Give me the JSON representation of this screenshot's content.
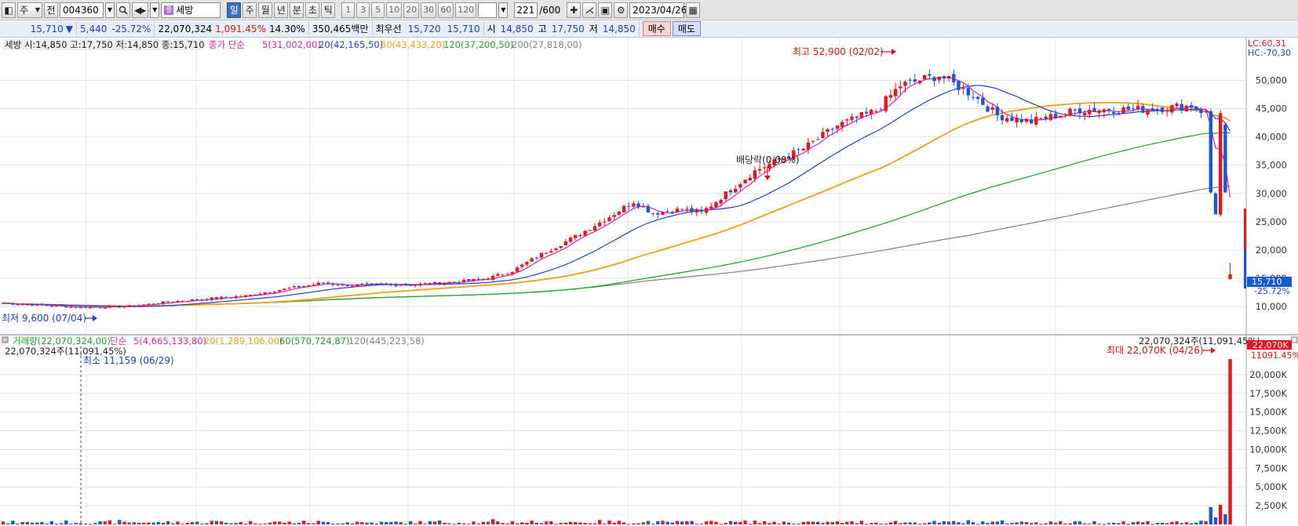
{
  "toolbar": {
    "market_type": "주",
    "scope": "전",
    "code": "004360",
    "stock_name": "세방",
    "periods": [
      "일",
      "주",
      "월",
      "년",
      "분",
      "초",
      "틱"
    ],
    "active_period": "일",
    "minute_options": [
      "1",
      "3",
      "5",
      "10",
      "20",
      "30",
      "60",
      "120"
    ],
    "count": "221",
    "count_max": "/600",
    "date": "2023/04/26"
  },
  "quote": {
    "price": "15,710",
    "direction": "▼",
    "change": "5,440",
    "change_pct": "-25.72%",
    "volume": "22,070,324",
    "volume_ratio": "1,091.45%",
    "turnover": "14.30%",
    "amount": "350,465백만",
    "best_ask_label": "최우선",
    "best_ask": "15,720",
    "best_bid": "15,710",
    "open_label": "시",
    "open": "14,850",
    "high_label": "고",
    "high": "17,750",
    "low_label": "저",
    "low": "14,850",
    "buy_label": "매수",
    "sell_label": "매도"
  },
  "price_legend": {
    "summary": "세방 시:14,850 고:17,750 저:14,850 종:15,710",
    "ma_title": "종가 단순",
    "ma5": "5(31,002,00)",
    "ma20": "20(42,165,50)",
    "ma50": "50(43,433,20)",
    "ma120": "120(37,200,50)",
    "ma200": "200(27,818,00)",
    "lc": "LC:60,31",
    "hc": "HC:-70,30"
  },
  "volume_legend": {
    "title": "거래량(22,070,324,00)",
    "ma_title": "단순",
    "ma5": "5(4,665,133,80)",
    "ma20": "20(1,289,106,00)",
    "ma60": "60(570,724,87)",
    "ma120": "120(445,223,58)",
    "left_readout": "22,070,324주(11,091,45%)",
    "right_readout": "22,070,324주(11,091,45%)"
  },
  "annotations": {
    "high": "최고 52,900 (02/02)",
    "low": "최저 9,600 (07/04)",
    "dividend": "배당락(0,00%)",
    "vol_max": "최대 22,070K (04/26)",
    "vol_min": "최소 11,159 (06/29)"
  },
  "price_badges": {
    "last": "15,710",
    "last_pct": "-25.72%",
    "vol_last": "22,070K",
    "vol_pct": "11091.45%"
  },
  "colors": {
    "up": "#e8141e",
    "down": "#1559d6",
    "ma5": "#e020b0",
    "ma20": "#1f3fcf",
    "ma50": "#f0a010",
    "ma120": "#1aa02a",
    "ma200": "#808080"
  },
  "chart_data": [
    {
      "type": "candlestick",
      "title": "세방",
      "ylim": [
        6000,
        54500
      ],
      "y_ticks": [
        10000,
        15000,
        20000,
        25000,
        30000,
        35000,
        40000,
        45000,
        50000
      ],
      "y_tick_labels": [
        "10,000",
        "15,000",
        "20,000",
        "25,000",
        "30,000",
        "35,000",
        "40,000",
        "45,000",
        "50,000"
      ],
      "bars": 221,
      "anchors_close": [
        [
          0,
          10600
        ],
        [
          15,
          9900
        ],
        [
          25,
          10000
        ],
        [
          35,
          10900
        ],
        [
          50,
          11900
        ],
        [
          58,
          13100
        ],
        [
          66,
          14200
        ],
        [
          70,
          13800
        ],
        [
          85,
          13900
        ],
        [
          95,
          14500
        ],
        [
          100,
          15000
        ],
        [
          105,
          16300
        ],
        [
          110,
          18800
        ],
        [
          118,
          22400
        ],
        [
          125,
          25900
        ],
        [
          130,
          28600
        ],
        [
          134,
          26500
        ],
        [
          140,
          27200
        ],
        [
          144,
          26600
        ],
        [
          147,
          28600
        ],
        [
          155,
          34000
        ],
        [
          165,
          37900
        ],
        [
          170,
          40800
        ],
        [
          172,
          42000
        ],
        [
          180,
          44600
        ],
        [
          185,
          49100
        ],
        [
          193,
          50900
        ],
        [
          200,
          47400
        ],
        [
          205,
          43800
        ],
        [
          212,
          42700
        ],
        [
          222,
          44800
        ],
        [
          235,
          44900
        ],
        [
          245,
          45500
        ],
        [
          248,
          44200
        ],
        [
          249,
          30200
        ],
        [
          253,
          15710
        ]
      ],
      "series": [
        {
          "name": "5",
          "values": [
            31002
          ]
        },
        {
          "name": "20",
          "values": [
            42165.5
          ]
        },
        {
          "name": "50",
          "values": [
            43433.2
          ]
        },
        {
          "name": "120",
          "values": [
            37200.5
          ]
        },
        {
          "name": "200",
          "values": [
            27818
          ]
        }
      ],
      "last": {
        "open": 14850,
        "high": 17750,
        "low": 14850,
        "close": 15710
      },
      "annotations": [
        {
          "text": "최고 52,900 (02/02)",
          "value": 52900
        },
        {
          "text": "최저 9,600 (07/04)",
          "value": 9600
        },
        {
          "text": "배당락(0,00%)"
        }
      ],
      "grid": true
    },
    {
      "type": "bar",
      "title": "거래량",
      "ylim": [
        0,
        22500000
      ],
      "y_ticks": [
        2500000,
        5000000,
        7500000,
        10000000,
        12500000,
        15000000,
        17500000,
        20000000
      ],
      "y_tick_labels": [
        "2,500K",
        "5,000K",
        "7,500K",
        "10,000K",
        "12,500K",
        "15,000K",
        "17,500K",
        "20,000K"
      ],
      "last_value": 22070324,
      "annotations": [
        {
          "text": "최대 22,070K (04/26)",
          "value": 22070324
        },
        {
          "text": "최소 11,159 (06/29)",
          "value": 11159
        }
      ],
      "grid": true
    }
  ]
}
